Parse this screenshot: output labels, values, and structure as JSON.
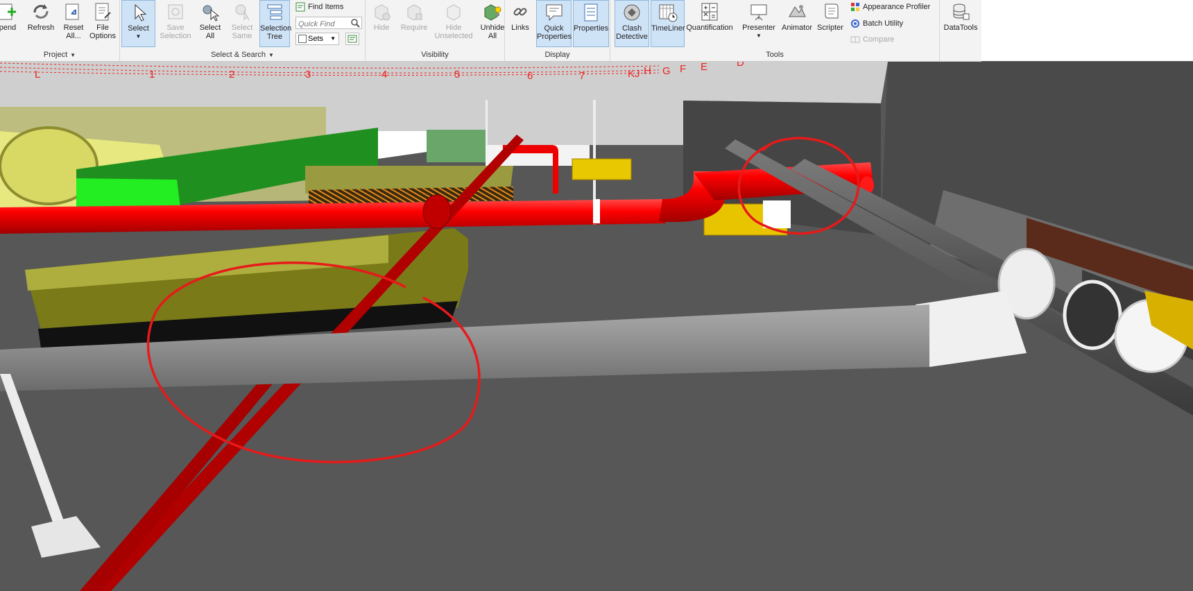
{
  "ribbon": {
    "project": {
      "label": "Project",
      "buttons": {
        "append": "pend",
        "refresh": "Refresh",
        "reset_all_1": "Reset",
        "reset_all_2": "All...",
        "file_options_1": "File",
        "file_options_2": "Options"
      }
    },
    "select_search": {
      "label": "Select & Search",
      "select": "Select",
      "save_selection_1": "Save",
      "save_selection_2": "Selection",
      "select_all_1": "Select",
      "select_all_2": "All",
      "select_same_1": "Select",
      "select_same_2": "Same",
      "selection_tree_1": "Selection",
      "selection_tree_2": "Tree",
      "find_items": "Find Items",
      "quick_find_placeholder": "Quick Find",
      "sets": "Sets"
    },
    "visibility": {
      "label": "Visibility",
      "hide": "Hide",
      "require": "Require",
      "hide_unselected_1": "Hide",
      "hide_unselected_2": "Unselected",
      "unhide_all_1": "Unhide",
      "unhide_all_2": "All"
    },
    "display": {
      "label": "Display",
      "links": "Links",
      "quick_properties_1": "Quick",
      "quick_properties_2": "Properties",
      "properties": "Properties"
    },
    "tools": {
      "label": "Tools",
      "clash_detective_1": "Clash",
      "clash_detective_2": "Detective",
      "timeliner": "TimeLiner",
      "quantification": "Quantification",
      "presenter": "Presenter",
      "animator": "Animator",
      "scripter": "Scripter",
      "appearance_profiler": "Appearance Profiler",
      "batch_utility": "Batch Utility",
      "compare": "Compare"
    },
    "datatools": {
      "label": "DataTools"
    }
  },
  "viewport": {
    "grid_labels": [
      "L",
      "1",
      "2",
      "3",
      "4",
      "5",
      "6",
      "7",
      "K",
      "J",
      "H",
      "G",
      "F",
      "E",
      "D"
    ]
  },
  "colors": {
    "pipe_red": "#e60000",
    "pipe_dark_red": "#9e0000",
    "pipe_gray": "#8a8a8a",
    "duct_yellow": "#c8c85a",
    "duct_green": "#1e9a1e",
    "markup_red": "#e61a1a"
  }
}
